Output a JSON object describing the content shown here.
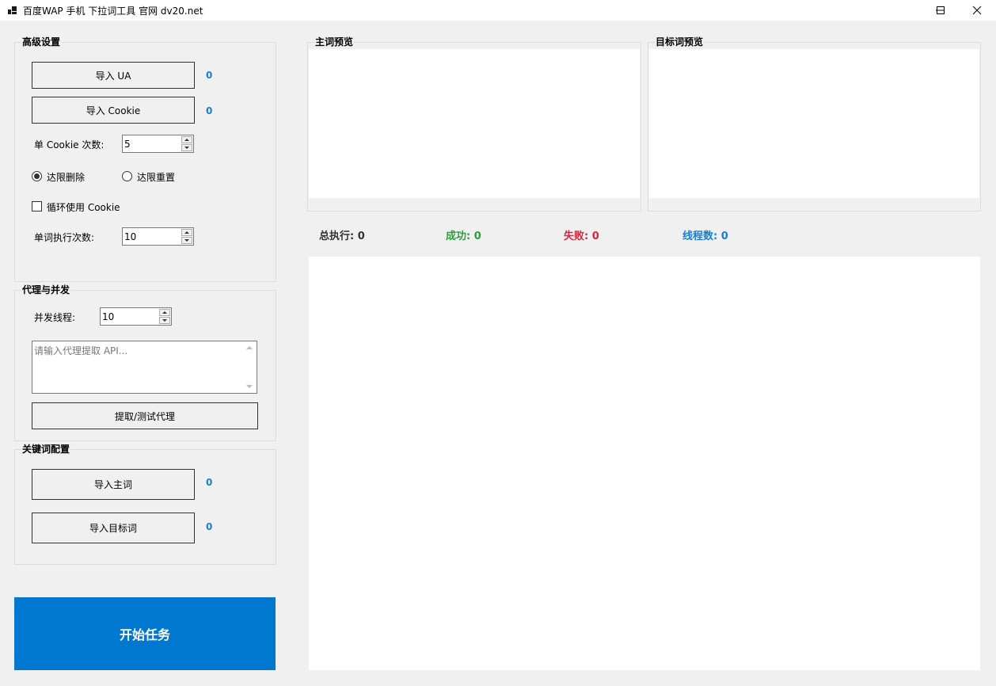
{
  "window": {
    "title": "百度WAP 手机 下拉词工具 官网 dv20.net",
    "icons": [
      "app-icon",
      "minimize-icon",
      "maximize-icon",
      "close-icon"
    ]
  },
  "advanced": {
    "title": "高级设置",
    "import_ua_label": "导入 UA",
    "ua_count": "0",
    "import_cookie_label": "导入 Cookie",
    "cookie_count": "0",
    "cookie_times_label": "单 Cookie 次数:",
    "cookie_times_value": "5",
    "radio_delete_label": "达限删除",
    "radio_reset_label": "达限重置",
    "radio_selected": "delete",
    "loop_cookie_label": "循环使用 Cookie",
    "loop_cookie_checked": false,
    "word_times_label": "单词执行次数:",
    "word_times_value": "10"
  },
  "proxy": {
    "title": "代理与并发",
    "threads_label": "并发线程:",
    "threads_value": "10",
    "api_placeholder": "请输入代理提取 API...",
    "api_value": "",
    "test_button_label": "提取/测试代理"
  },
  "keywords": {
    "title": "关键词配置",
    "import_main_label": "导入主词",
    "main_count": "0",
    "import_target_label": "导入目标词",
    "target_count": "0"
  },
  "start_button_label": "开始任务",
  "preview": {
    "main_title": "主词预览",
    "target_title": "目标词预览"
  },
  "stats": {
    "total": "总执行: 0",
    "success": "成功: 0",
    "fail": "失败: 0",
    "threads": "线程数: 0"
  },
  "colors": {
    "accent": "#0078d0",
    "count_blue": "#1a7fd0",
    "success_green": "#2e9e3e",
    "fail_red": "#d9253b",
    "threads_blue": "#1a7fd0"
  }
}
